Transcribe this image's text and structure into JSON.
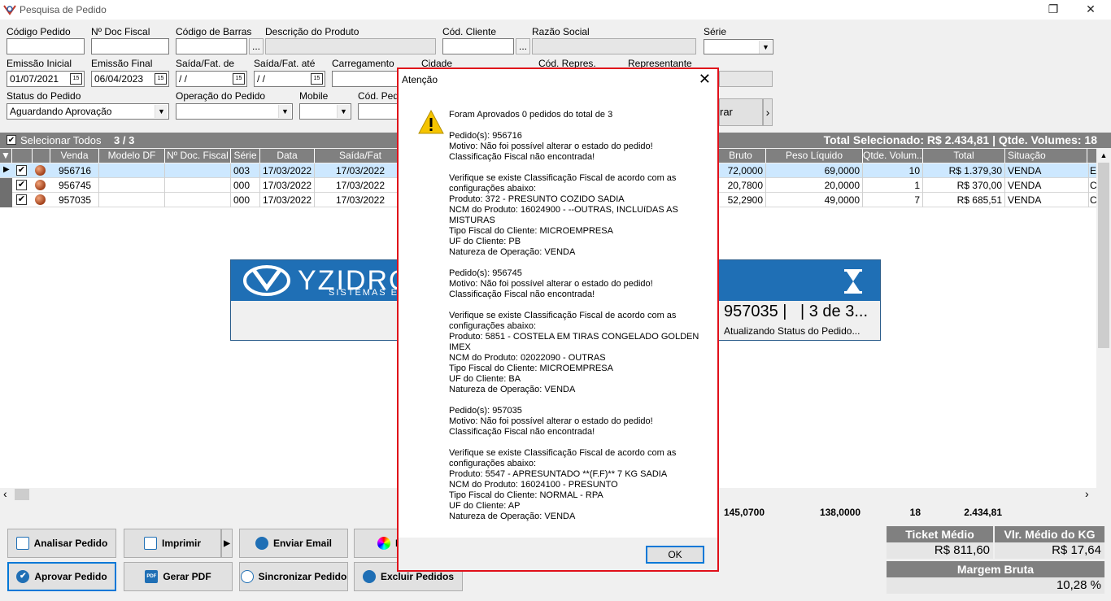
{
  "window": {
    "title": "Pesquisa de Pedido"
  },
  "filters": {
    "codigo_pedido": {
      "label": "Código Pedido",
      "value": ""
    },
    "nr_doc_fiscal": {
      "label": "Nº Doc Fiscal",
      "value": ""
    },
    "codigo_barras": {
      "label": "Código de Barras",
      "value": ""
    },
    "descricao_produto": {
      "label": "Descrição do Produto",
      "value": ""
    },
    "cod_cliente": {
      "label": "Cód. Cliente",
      "value": ""
    },
    "razao_social": {
      "label": "Razão Social",
      "value": ""
    },
    "serie": {
      "label": "Série",
      "value": ""
    },
    "emissao_inicial": {
      "label": "Emissão Inicial",
      "value": "01/07/2021"
    },
    "emissao_final": {
      "label": "Emissão Final",
      "value": "06/04/2023"
    },
    "saida_de": {
      "label": "Saída/Fat. de",
      "value": " / /"
    },
    "saida_ate": {
      "label": "Saída/Fat. até",
      "value": " / /"
    },
    "carregamento": {
      "label": "Carregamento",
      "value": ""
    },
    "cidade": {
      "label": "Cidade"
    },
    "cod_repres": {
      "label": "Cód. Repres."
    },
    "representante": {
      "label": "Representante"
    },
    "status": {
      "label": "Status do Pedido",
      "value": "Aguardando Aprovação"
    },
    "operacao": {
      "label": "Operação do Pedido",
      "value": ""
    },
    "mobile": {
      "label": "Mobile",
      "value": ""
    },
    "cod_pedido2": {
      "label": "Cód. Pedi"
    },
    "filtrar_button": "rar",
    "dots": "..."
  },
  "selection": {
    "select_all_label": "Selecionar Todos",
    "count": "3 / 3",
    "summary": "Total Selecionado: R$ 2.434,81 | Qtde. Volumes: 18"
  },
  "grid": {
    "columns": [
      "Venda",
      "Modelo DF",
      "Nº Doc. Fiscal",
      "Série",
      "Data",
      "Saída/Fat",
      "Bruto",
      "Peso Líquido",
      "Qtde. Volum...",
      "Total",
      "Situação"
    ],
    "rows": [
      {
        "venda": "956716",
        "modelo": "",
        "doc": "",
        "serie": "003",
        "data": "17/03/2022",
        "saida": "17/03/2022",
        "bruto": "72,0000",
        "peso": "69,0000",
        "volumes": "10",
        "total": "R$ 1.379,30",
        "situacao": "VENDA",
        "extra": "E"
      },
      {
        "venda": "956745",
        "modelo": "",
        "doc": "",
        "serie": "000",
        "data": "17/03/2022",
        "saida": "17/03/2022",
        "bruto": "20,7800",
        "peso": "20,0000",
        "volumes": "1",
        "total": "R$ 370,00",
        "situacao": "VENDA",
        "extra": "C"
      },
      {
        "venda": "957035",
        "modelo": "",
        "doc": "",
        "serie": "000",
        "data": "17/03/2022",
        "saida": "17/03/2022",
        "bruto": "52,2900",
        "peso": "49,0000",
        "volumes": "7",
        "total": "R$ 685,51",
        "situacao": "VENDA",
        "extra": "C"
      }
    ],
    "totals": {
      "bruto": "145,0700",
      "peso": "138,0000",
      "volumes": "18",
      "total": "2.434,81"
    }
  },
  "progress": {
    "brand": "YZIDRO",
    "brand_sub": "SISTEMAS E",
    "current": "957035 |",
    "count": "| 3 de 3...",
    "status": "Atualizando Status do Pedido..."
  },
  "buttons": {
    "analisar": "Analisar Pedido",
    "imprimir": "Imprimir",
    "enviar_email": "Enviar Email",
    "aprovar": "Aprovar Pedido",
    "gerar_pdf": "Gerar PDF",
    "sincronizar": "Sincronizar Pedido",
    "excluir": "Excluir Pedidos",
    "pdf_icon_text": "PDF",
    "l_partial": "L"
  },
  "stats": {
    "ticket_medio_label": "Ticket Médio",
    "ticket_medio": "R$ 811,60",
    "vlr_medio_kg_label": "Vlr. Médio do KG",
    "vlr_medio_kg": "R$ 17,64",
    "margem_label": "Margem Bruta",
    "margem": "10,28 %"
  },
  "dialog": {
    "title": "Atenção",
    "message": "Foram Aprovados 0 pedidos do total de 3\n\nPedido(s): 956716\nMotivo: Não foi possível alterar o estado do pedido!\nClassificação Fiscal não encontrada!\n\nVerifique se existe Classificação Fiscal de acordo com as configurações abaixo:\nProduto: 372 - PRESUNTO COZIDO SADIA\nNCM do Produto: 16024900 - --OUTRAS, INCLUíDAS AS MISTURAS\nTipo Fiscal do Cliente: MICROEMPRESA\nUF do Cliente: PB\nNatureza de Operação: VENDA\n\nPedido(s): 956745\nMotivo: Não foi possível alterar o estado do pedido!\nClassificação Fiscal não encontrada!\n\nVerifique se existe Classificação Fiscal de acordo com as configurações abaixo:\nProduto: 5851 - COSTELA EM TIRAS CONGELADO GOLDEN IMEX\nNCM do Produto: 02022090 - OUTRAS\nTipo Fiscal do Cliente: MICROEMPRESA\nUF do Cliente: BA\nNatureza de Operação: VENDA\n\nPedido(s): 957035\nMotivo: Não foi possível alterar o estado do pedido!\nClassificação Fiscal não encontrada!\n\nVerifique se existe Classificação Fiscal de acordo com as configurações abaixo:\nProduto: 5547 - APRESUNTADO **(F.F)** 7 KG SADIA\nNCM do Produto: 16024100 - PRESUNTO\nTipo Fiscal do Cliente: NORMAL - RPA\nUF do Cliente: AP\nNatureza de Operação: VENDA",
    "ok": "OK"
  },
  "glyphs": {
    "close": "✕",
    "restore": "❐",
    "warn": "!",
    "check": "✔",
    "cal": "15",
    "dd": "▼",
    "right": "▶",
    "left": "◀",
    "chev_r": "›",
    "chev_l": "‹",
    "up": "▲"
  }
}
